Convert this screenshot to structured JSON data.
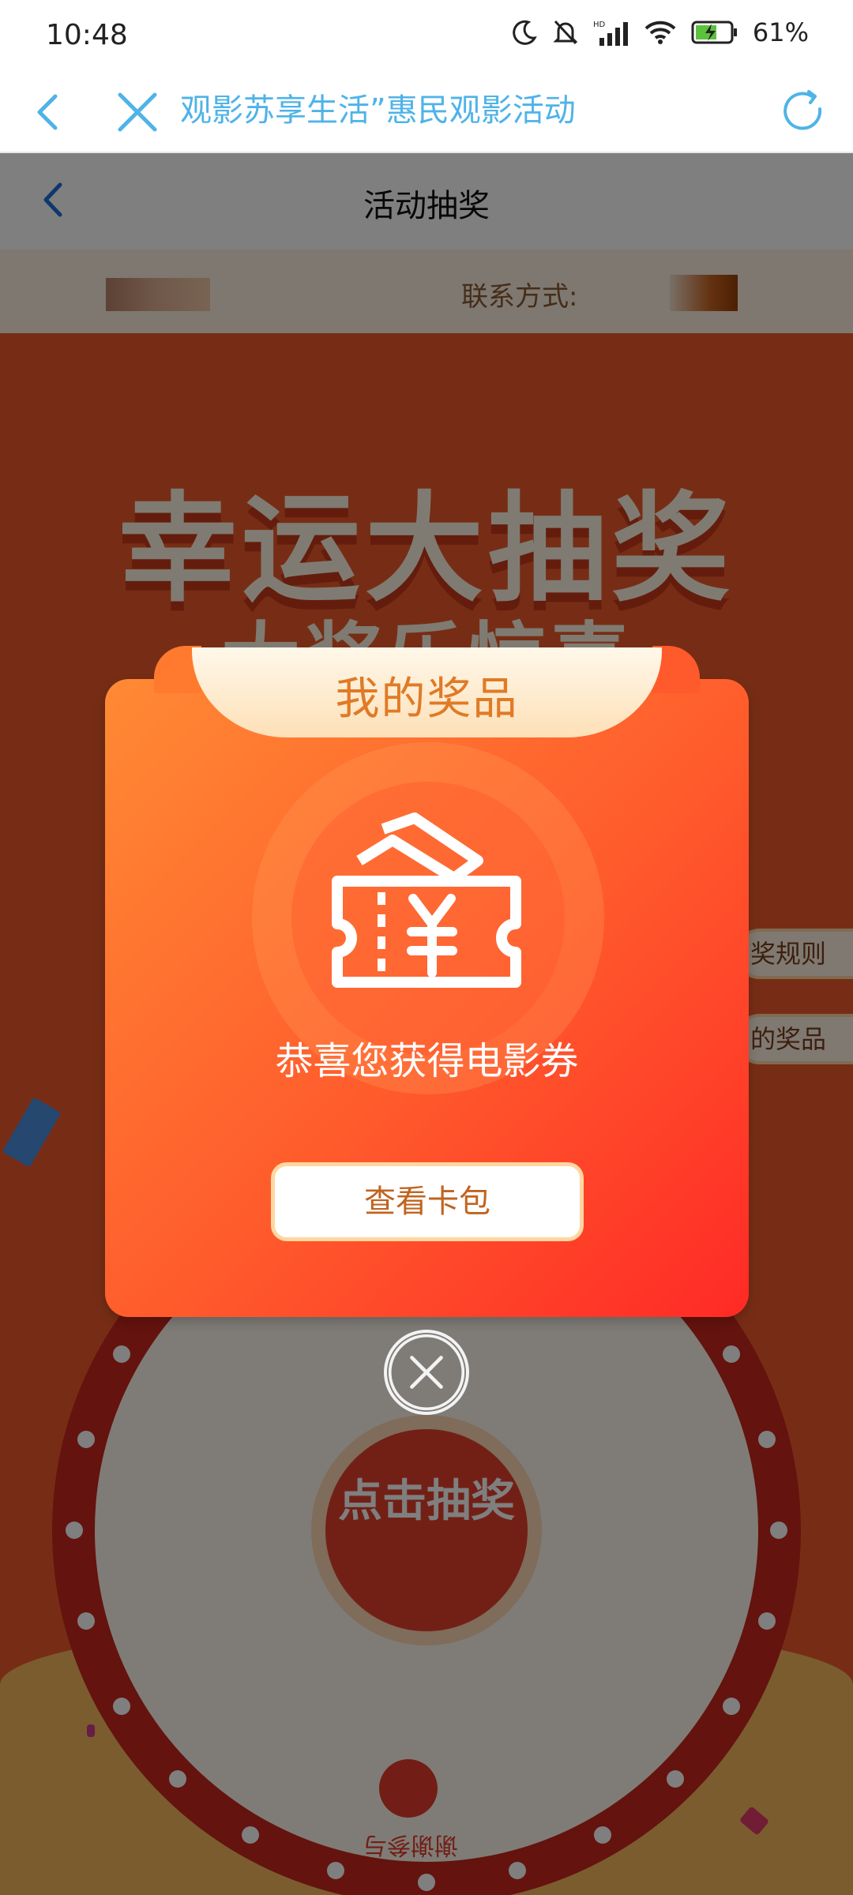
{
  "status_bar": {
    "time": "10:48",
    "battery": "61%"
  },
  "browser": {
    "title": "观影苏享生活”惠民观影活动"
  },
  "page": {
    "header_title": "活动抽奖",
    "contact_label": "联系方式:",
    "banner_title": "幸运大抽奖",
    "banner_subtitle": "大奖乐惊喜",
    "side_tabs": [
      "奖规则",
      "的奖品"
    ],
    "wheel_button": "点击抽奖",
    "wheel_prize": "谢谢参与"
  },
  "modal": {
    "header": "我的奖品",
    "message": "恭喜您获得电影券",
    "button": "查看卡包",
    "icon": "movie-coupon-icon",
    "colors": {
      "gradient_start": "#ff8a34",
      "gradient_end": "#ff2a26",
      "button_text": "#c0641f"
    }
  }
}
